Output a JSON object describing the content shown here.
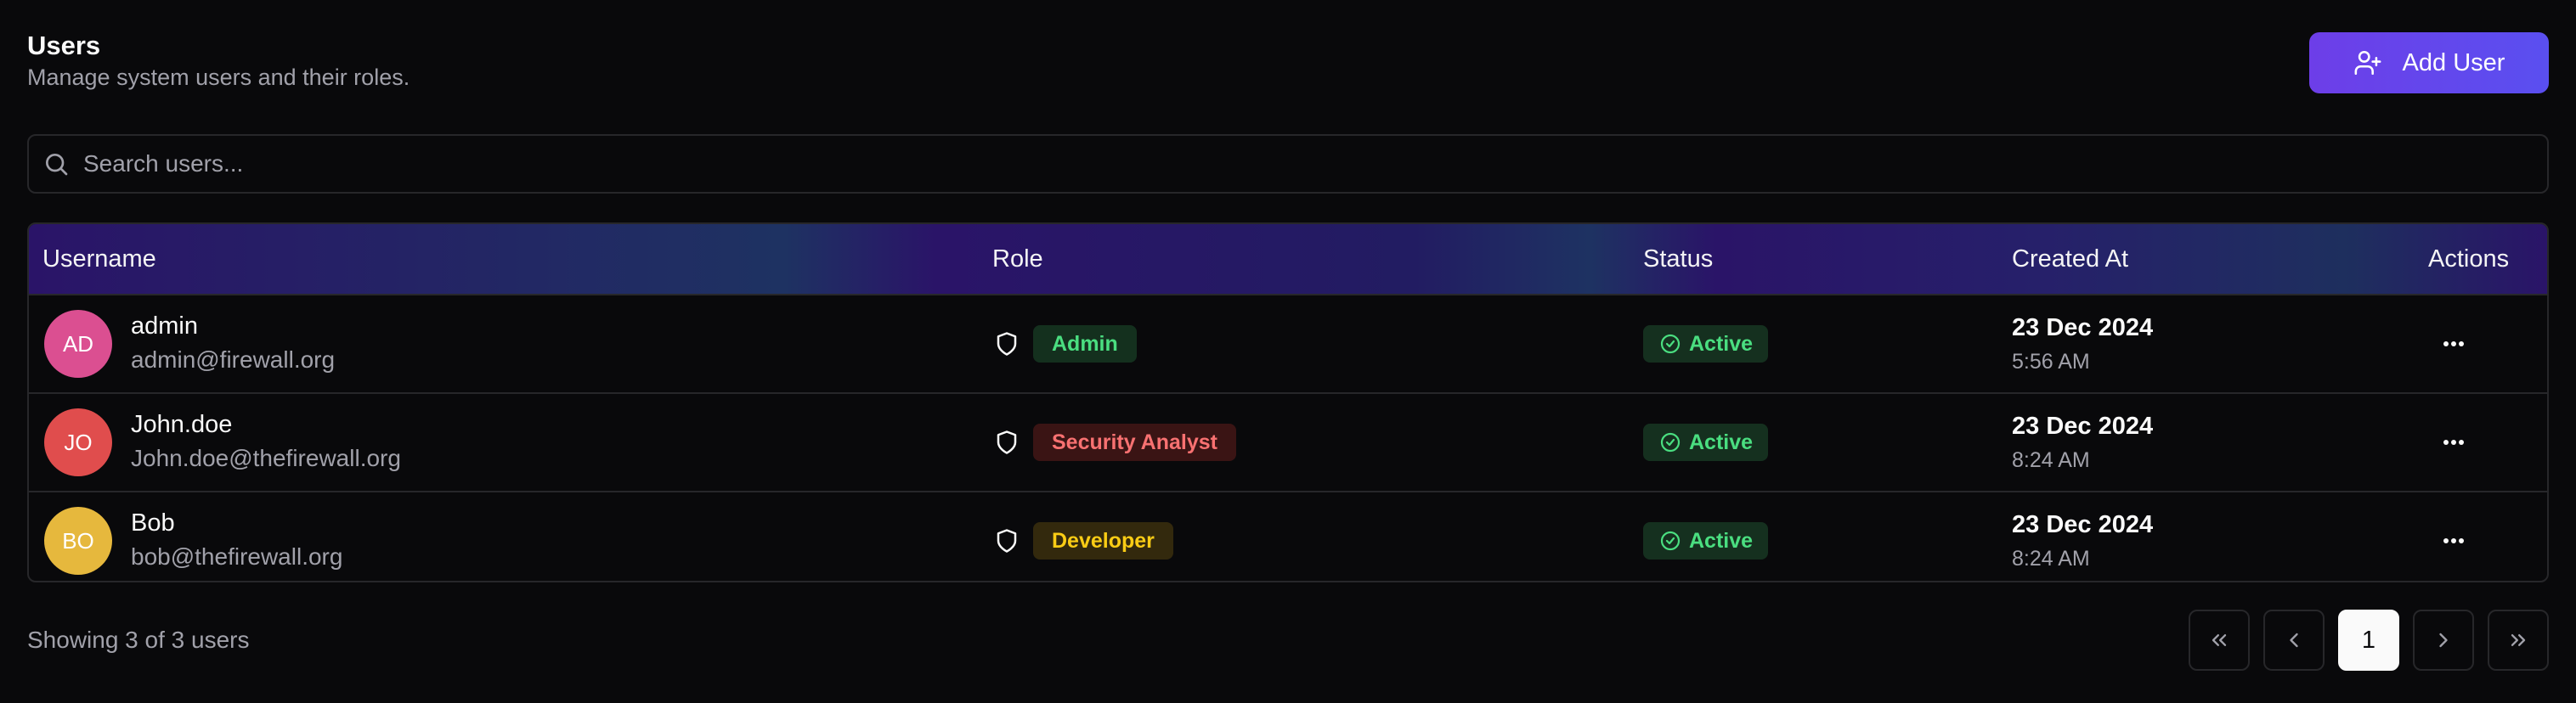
{
  "header": {
    "title": "Users",
    "subtitle": "Manage system users and their roles.",
    "add_user_label": "Add User"
  },
  "search": {
    "placeholder": "Search users...",
    "value": ""
  },
  "table": {
    "columns": [
      "Username",
      "Role",
      "Status",
      "Created At",
      "Actions"
    ],
    "rows": [
      {
        "initials": "AD",
        "avatar_color": "#db4f91",
        "username": "admin",
        "email": "admin@firewall.org",
        "role": "Admin",
        "role_bg": "#14301e",
        "role_fg": "#4ade80",
        "status": "Active",
        "date": "23 Dec 2024",
        "time": "5:56 AM"
      },
      {
        "initials": "JO",
        "avatar_color": "#e04d4d",
        "username": "John.doe",
        "email": "John.doe@thefirewall.org",
        "role": "Security Analyst",
        "role_bg": "#3a1414",
        "role_fg": "#f87171",
        "status": "Active",
        "date": "23 Dec 2024",
        "time": "8:24 AM"
      },
      {
        "initials": "BO",
        "avatar_color": "#e6b83d",
        "username": "Bob",
        "email": "bob@thefirewall.org",
        "role": "Developer",
        "role_bg": "#33290d",
        "role_fg": "#facc15",
        "status": "Active",
        "date": "23 Dec 2024",
        "time": "8:24 AM"
      }
    ]
  },
  "footer": {
    "summary": "Showing 3 of 3 users"
  },
  "pagination": {
    "current_page": "1"
  },
  "icons": {
    "add_user": "user-plus-icon",
    "search": "search-icon",
    "role": "shield-icon",
    "status": "check-circle-icon",
    "actions": "more-horizontal-icon",
    "first": "chevrons-left-icon",
    "prev": "chevron-left-icon",
    "next": "chevron-right-icon",
    "last": "chevrons-right-icon"
  },
  "colors": {
    "accent": "#6d3ee8",
    "status_active_bg": "#15301f",
    "status_active_fg": "#4ade80"
  }
}
